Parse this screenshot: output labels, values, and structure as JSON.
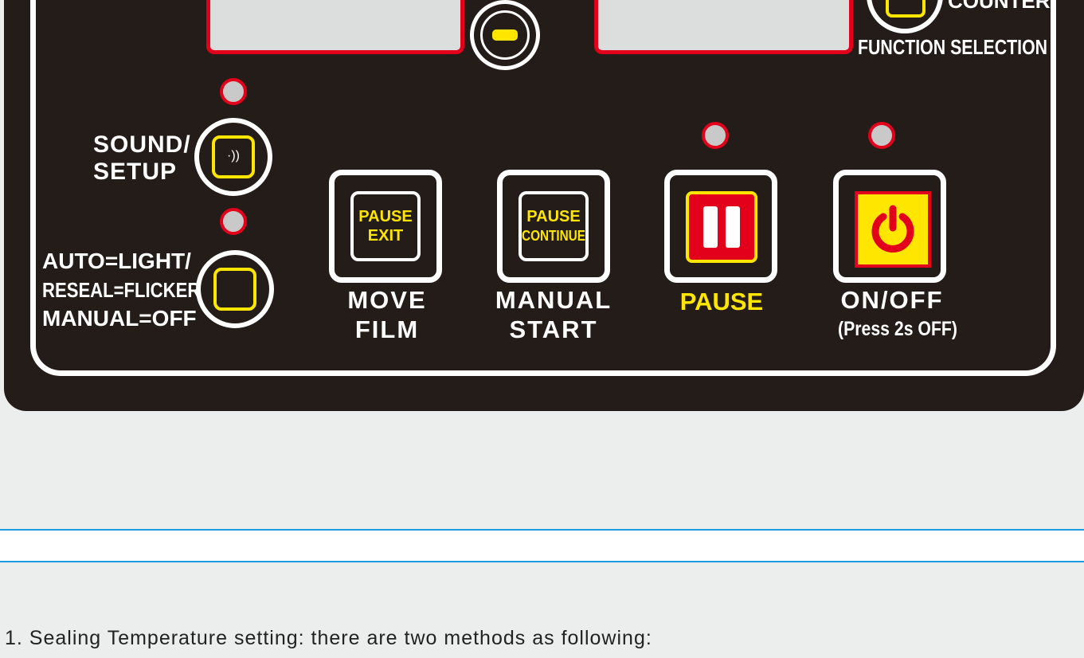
{
  "panel": {
    "counter_label": "COUNTER/",
    "function_selection_label": "FUNCTION SELECTION",
    "sound_setup_label": {
      "line1": "SOUND/",
      "line2": "SETUP"
    },
    "sound_icon_glyph": "·))",
    "mode_label": {
      "line1": "AUTO=LIGHT/",
      "line2": "RESEAL=FLICKER/",
      "line3": "MANUAL=OFF"
    },
    "buttons": [
      {
        "inner_line1": "PAUSE",
        "inner_line2": "EXIT",
        "caption_line1": "MOVE",
        "caption_line2": "FILM"
      },
      {
        "inner_line1": "PAUSE",
        "inner_line2": "CONTINUE",
        "caption_line1": "MANUAL",
        "caption_line2": "START"
      },
      {
        "caption_line1": "PAUSE"
      },
      {
        "caption_line1": "ON/OFF",
        "caption_line2": "(Press 2s OFF)"
      }
    ],
    "icons": [
      "minus-icon",
      "sound-icon",
      "pause-icon",
      "power-icon"
    ],
    "colors": {
      "panel": "#231c19",
      "accent_red": "#e3001b",
      "accent_yellow": "#ffe600",
      "stripe_blue": "#1e9be0"
    }
  },
  "document": {
    "instruction": "1. Sealing Temperature setting: there are two methods as following:"
  }
}
